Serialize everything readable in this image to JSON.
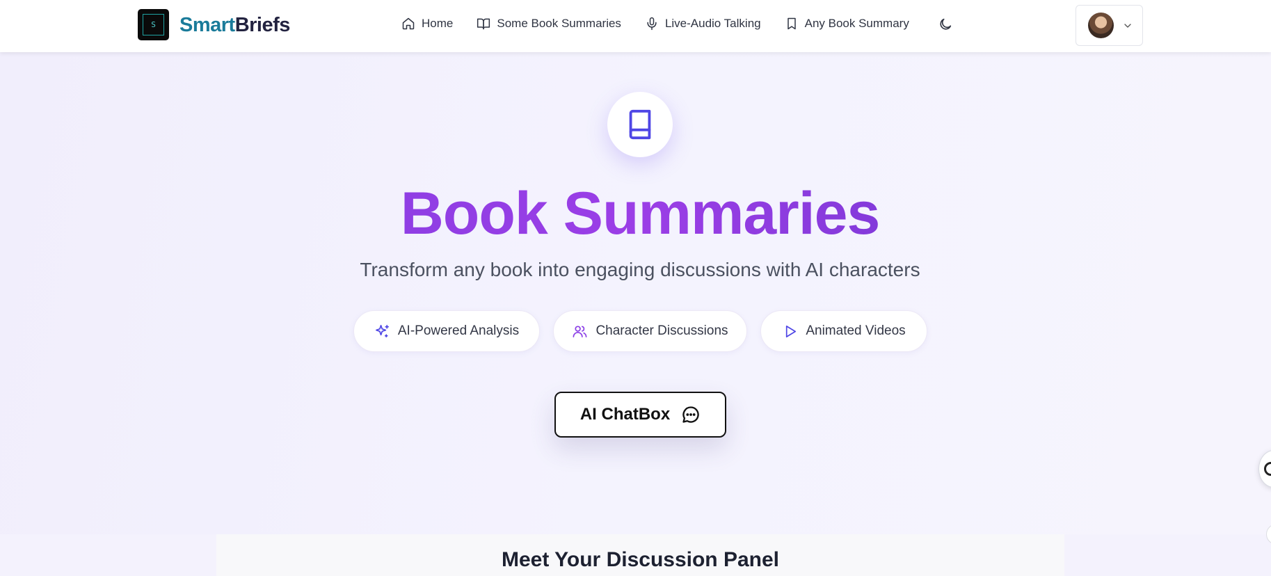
{
  "brand": {
    "word1": "Smart",
    "word2": "Briefs",
    "logo_letter": "S"
  },
  "nav": [
    {
      "label": "Home",
      "icon": "home-icon"
    },
    {
      "label": "Some Book Summaries",
      "icon": "book-open-icon"
    },
    {
      "label": "Live-Audio Talking",
      "icon": "microphone-icon"
    },
    {
      "label": "Any Book Summary",
      "icon": "bookmark-icon"
    }
  ],
  "theme_toggle_icon": "moon-icon",
  "hero": {
    "icon": "book-icon",
    "title": "Book Summaries",
    "subtitle": "Transform any book into engaging discussions with AI characters",
    "features": [
      {
        "label": "AI-Powered Analysis",
        "icon": "sparkles-icon"
      },
      {
        "label": "Character Discussions",
        "icon": "users-icon"
      },
      {
        "label": "Animated Videos",
        "icon": "play-icon"
      }
    ],
    "cta_label": "AI ChatBox"
  },
  "panel": {
    "title": "Meet Your Discussion Panel"
  },
  "colors": {
    "accent": "#7b3fe0",
    "brand_teal": "#1a7b9a",
    "brand_dark": "#232340",
    "icon_indigo": "#4f46e5"
  }
}
